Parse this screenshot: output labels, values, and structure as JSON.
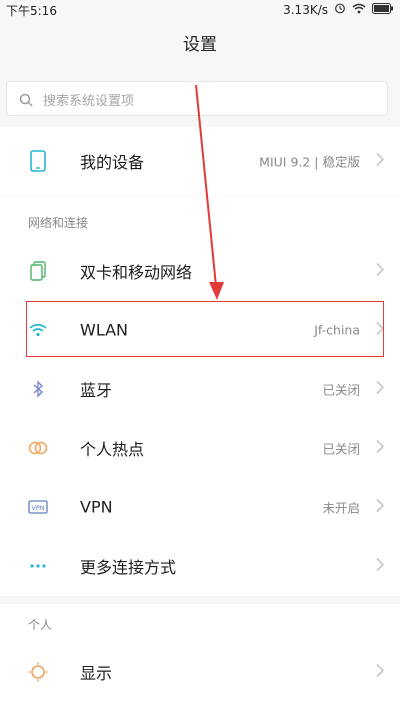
{
  "statusbar": {
    "time": "下午5:16",
    "speed": "3.13K/s"
  },
  "header": {
    "title": "设置"
  },
  "search": {
    "placeholder": "搜索系统设置项"
  },
  "device": {
    "label": "我的设备",
    "value": "MIUI 9.2 | 稳定版"
  },
  "network": {
    "section": "网络和连接",
    "items": [
      {
        "label": "双卡和移动网络",
        "value": ""
      },
      {
        "label": "WLAN",
        "value": "Jf-china"
      },
      {
        "label": "蓝牙",
        "value": "已关闭"
      },
      {
        "label": "个人热点",
        "value": "已关闭"
      },
      {
        "label": "VPN",
        "value": "未开启"
      },
      {
        "label": "更多连接方式",
        "value": ""
      }
    ]
  },
  "personal": {
    "section": "个人",
    "items": [
      {
        "label": "显示",
        "value": ""
      }
    ]
  },
  "colors": {
    "accent": "#26b6d4",
    "highlight": "#e23a3a",
    "orange": "#f0a35a"
  }
}
